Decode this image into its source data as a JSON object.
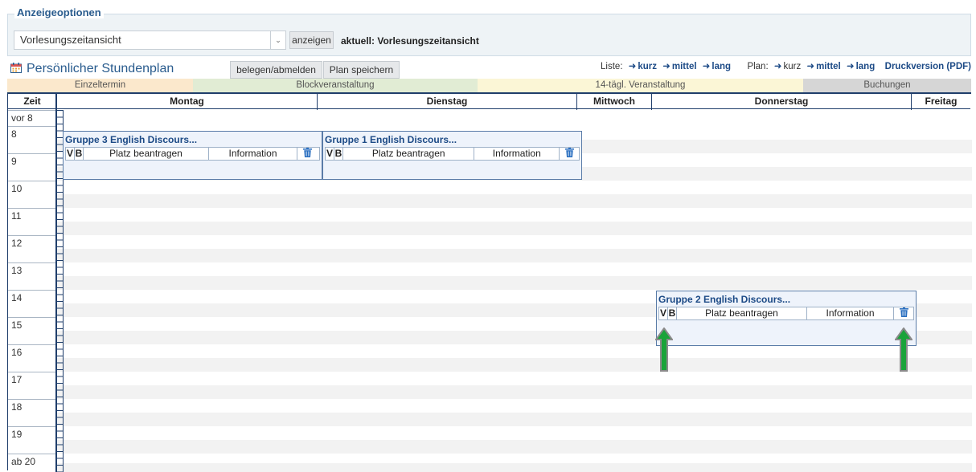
{
  "options": {
    "legend": "Anzeigeoptionen",
    "select_value": "Vorlesungszeitansicht",
    "show_button": "anzeigen",
    "current": "aktuell: Vorlesungszeitansicht"
  },
  "plan": {
    "title": "Persönlicher Stundenplan",
    "belegen_button": "belegen/abmelden",
    "save_button": "Plan speichern",
    "liste_label": "Liste:",
    "plan_label": "Plan:",
    "kurz": "kurz",
    "mittel": "mittel",
    "lang": "lang",
    "druck": "Druckversion (PDF)"
  },
  "legendbar": {
    "einzeltermin": "Einzeltermin",
    "block": "Blockveranstaltung",
    "biweekly": "14-tägl. Veranstaltung",
    "buchungen": "Buchungen",
    "colors": {
      "einzeltermin": "#fbe8cc",
      "block": "#e1ecd4",
      "biweekly": "#fbf6d6",
      "buchungen": "#d6d6d6"
    }
  },
  "grid": {
    "zeit": "Zeit",
    "days": [
      "Montag",
      "Dienstag",
      "Mittwoch",
      "Donnerstag",
      "Freitag"
    ],
    "times": [
      "vor 8",
      "8",
      "9",
      "10",
      "11",
      "12",
      "13",
      "14",
      "15",
      "16",
      "17",
      "18",
      "19",
      "ab 20"
    ]
  },
  "events": [
    {
      "title": "Gruppe 3 English Discours...",
      "v": "V",
      "b": "B",
      "request": "Platz beantragen",
      "info": "Information"
    },
    {
      "title": "Gruppe 1 English Discours...",
      "v": "V",
      "b": "B",
      "request": "Platz beantragen",
      "info": "Information"
    },
    {
      "title": "Gruppe 2 English Discours...",
      "v": "V",
      "b": "B",
      "request": "Platz beantragen",
      "info": "Information"
    }
  ],
  "colors": {
    "accent": "#2a5c8e",
    "grid_line": "#1f3e6b",
    "event_bg": "#eef3fb",
    "arrow_green": "#1aa33a"
  },
  "icons": {
    "calendar": "calendar-icon",
    "trash": "trash-icon",
    "arrow": "arrow-up-icon",
    "chevron": "chevron-down-icon",
    "link_arrow": "arrow-right-icon"
  }
}
